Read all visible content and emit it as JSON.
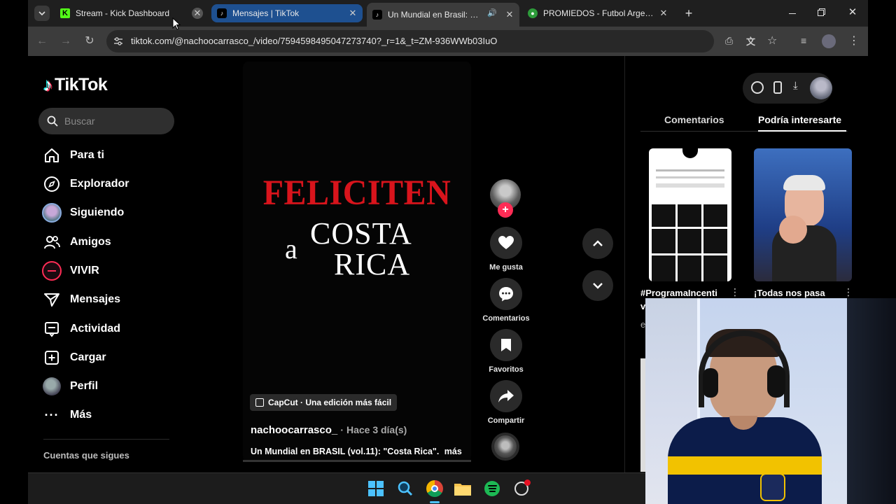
{
  "browser": {
    "tabs": [
      {
        "title": "Stream - Kick Dashboard",
        "icon": "kick-logo-icon",
        "state": "inactive"
      },
      {
        "title": "Mensajes | TikTok",
        "icon": "tiktok-logo-icon",
        "state": "hovered"
      },
      {
        "title": "Un Mundial en Brasil: Costa",
        "icon": "tiktok-logo-icon",
        "state": "active",
        "audio": true
      },
      {
        "title": "PROMIEDOS - Futbol Argentino",
        "icon": "promiedos-logo-icon",
        "state": "inactive"
      }
    ],
    "new_tab_symbol": "+",
    "url": "tiktok.com/@nachoocarrasco_/video/7594598495047273740?_r=1&_t=ZM-936WWb03IuO",
    "colors": {
      "tab_active_bg": "#3c3c3c",
      "tab_hover_bg": "#1e5090",
      "toolbar_bg": "#3c3c3c"
    }
  },
  "tiktok": {
    "logo_text": "TikTok",
    "search_placeholder": "Buscar",
    "nav": [
      {
        "label": "Para ti",
        "icon": "home-icon"
      },
      {
        "label": "Explorador",
        "icon": "compass-icon"
      },
      {
        "label": "Siguiendo",
        "icon": "avatar-icon"
      },
      {
        "label": "Amigos",
        "icon": "friends-icon"
      },
      {
        "label": "VIVIR",
        "icon": "live-icon"
      },
      {
        "label": "Mensajes",
        "icon": "paper-plane-icon"
      },
      {
        "label": "Actividad",
        "icon": "activity-icon"
      },
      {
        "label": "Cargar",
        "icon": "upload-plus-icon"
      },
      {
        "label": "Perfil",
        "icon": "profile-avatar-icon"
      },
      {
        "label": "Más",
        "icon": "more-dots-icon"
      }
    ],
    "following_header": "Cuentas que sigues",
    "video": {
      "title_line1": "FELICITEN",
      "title_a": "a",
      "title_line2": "COSTA",
      "title_line3": "RICA",
      "capcut_badge": "CapCut · Una edición más fácil",
      "author": "nachoocarrasco_",
      "time_ago": "· Hace 3 día(s)",
      "caption": "Un Mundial en BRASIL (vol.11): \"Costa Rica\".",
      "more": "más"
    },
    "actions": [
      {
        "label": "Me gusta",
        "icon": "heart-icon"
      },
      {
        "label": "Comentarios",
        "icon": "comment-icon"
      },
      {
        "label": "Favoritos",
        "icon": "bookmark-icon"
      },
      {
        "label": "Compartir",
        "icon": "share-icon"
      }
    ],
    "right_panel": {
      "tab_comments": "Comentarios",
      "tab_suggested": "Podría interesarte",
      "suggestion_1_title": "#ProgramaIncenti",
      "suggestion_1_line2": "v",
      "suggestion_1_line3": "e",
      "suggestion_2_title": "¡Todas nos pasa"
    },
    "colors": {
      "accent": "#fe2c55",
      "red_title": "#d8141c"
    }
  },
  "taskbar": {
    "apps": [
      "windows-start-icon",
      "search-icon",
      "chrome-icon",
      "file-explorer-icon",
      "spotify-icon",
      "app-icon"
    ]
  }
}
